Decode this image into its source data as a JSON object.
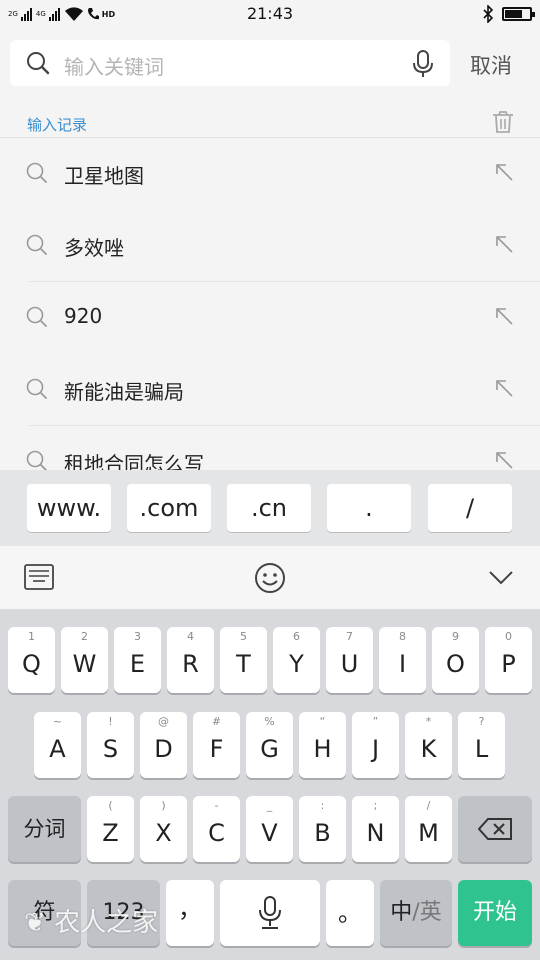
{
  "status_bar": {
    "signal_1_label": "2G",
    "signal_2_label": "4G",
    "hd_label": "HD",
    "time": "21:43",
    "battery_percent": 70
  },
  "search": {
    "placeholder": "输入关键词",
    "cancel_label": "取消"
  },
  "history": {
    "title": "输入记录",
    "items": [
      {
        "text": "卫星地图"
      },
      {
        "text": "多效唑"
      },
      {
        "text": "920"
      },
      {
        "text": "新能油是骗局"
      },
      {
        "text": "租地合同怎么写"
      }
    ]
  },
  "suggestions": [
    "www.",
    ".com",
    ".cn",
    ".",
    "/"
  ],
  "keyboard": {
    "row1": [
      {
        "hint": "1",
        "label": "Q"
      },
      {
        "hint": "2",
        "label": "W"
      },
      {
        "hint": "3",
        "label": "E"
      },
      {
        "hint": "4",
        "label": "R"
      },
      {
        "hint": "5",
        "label": "T"
      },
      {
        "hint": "6",
        "label": "Y"
      },
      {
        "hint": "7",
        "label": "U"
      },
      {
        "hint": "8",
        "label": "I"
      },
      {
        "hint": "9",
        "label": "O"
      },
      {
        "hint": "0",
        "label": "P"
      }
    ],
    "row2": [
      {
        "hint": "~",
        "label": "A"
      },
      {
        "hint": "!",
        "label": "S"
      },
      {
        "hint": "@",
        "label": "D"
      },
      {
        "hint": "#",
        "label": "F"
      },
      {
        "hint": "%",
        "label": "G"
      },
      {
        "hint": "“",
        "label": "H"
      },
      {
        "hint": "”",
        "label": "J"
      },
      {
        "hint": "*",
        "label": "K"
      },
      {
        "hint": "?",
        "label": "L"
      }
    ],
    "row3_left": "分词",
    "row3": [
      {
        "hint": "(",
        "label": "Z"
      },
      {
        "hint": ")",
        "label": "X"
      },
      {
        "hint": "-",
        "label": "C"
      },
      {
        "hint": "_",
        "label": "V"
      },
      {
        "hint": ":",
        "label": "B"
      },
      {
        "hint": ";",
        "label": "N"
      },
      {
        "hint": "/",
        "label": "M"
      }
    ],
    "symbol_key": "符",
    "number_key": "123",
    "comma_key": "，",
    "period_key": "。",
    "lang_key_active": "中",
    "lang_key_sep": "/",
    "lang_key_inactive": "英",
    "enter_key": "开始",
    "enter_color": "#2fc48f"
  },
  "watermark": "农人之家"
}
